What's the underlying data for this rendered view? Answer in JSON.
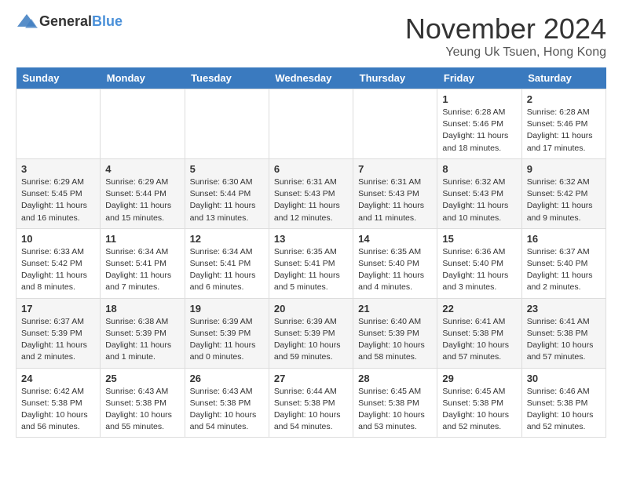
{
  "header": {
    "logo_general": "General",
    "logo_blue": "Blue",
    "month_title": "November 2024",
    "location": "Yeung Uk Tsuen, Hong Kong"
  },
  "days_of_week": [
    "Sunday",
    "Monday",
    "Tuesday",
    "Wednesday",
    "Thursday",
    "Friday",
    "Saturday"
  ],
  "weeks": [
    [
      {
        "day": "",
        "info": ""
      },
      {
        "day": "",
        "info": ""
      },
      {
        "day": "",
        "info": ""
      },
      {
        "day": "",
        "info": ""
      },
      {
        "day": "",
        "info": ""
      },
      {
        "day": "1",
        "info": "Sunrise: 6:28 AM\nSunset: 5:46 PM\nDaylight: 11 hours and 18 minutes."
      },
      {
        "day": "2",
        "info": "Sunrise: 6:28 AM\nSunset: 5:46 PM\nDaylight: 11 hours and 17 minutes."
      }
    ],
    [
      {
        "day": "3",
        "info": "Sunrise: 6:29 AM\nSunset: 5:45 PM\nDaylight: 11 hours and 16 minutes."
      },
      {
        "day": "4",
        "info": "Sunrise: 6:29 AM\nSunset: 5:44 PM\nDaylight: 11 hours and 15 minutes."
      },
      {
        "day": "5",
        "info": "Sunrise: 6:30 AM\nSunset: 5:44 PM\nDaylight: 11 hours and 13 minutes."
      },
      {
        "day": "6",
        "info": "Sunrise: 6:31 AM\nSunset: 5:43 PM\nDaylight: 11 hours and 12 minutes."
      },
      {
        "day": "7",
        "info": "Sunrise: 6:31 AM\nSunset: 5:43 PM\nDaylight: 11 hours and 11 minutes."
      },
      {
        "day": "8",
        "info": "Sunrise: 6:32 AM\nSunset: 5:43 PM\nDaylight: 11 hours and 10 minutes."
      },
      {
        "day": "9",
        "info": "Sunrise: 6:32 AM\nSunset: 5:42 PM\nDaylight: 11 hours and 9 minutes."
      }
    ],
    [
      {
        "day": "10",
        "info": "Sunrise: 6:33 AM\nSunset: 5:42 PM\nDaylight: 11 hours and 8 minutes."
      },
      {
        "day": "11",
        "info": "Sunrise: 6:34 AM\nSunset: 5:41 PM\nDaylight: 11 hours and 7 minutes."
      },
      {
        "day": "12",
        "info": "Sunrise: 6:34 AM\nSunset: 5:41 PM\nDaylight: 11 hours and 6 minutes."
      },
      {
        "day": "13",
        "info": "Sunrise: 6:35 AM\nSunset: 5:41 PM\nDaylight: 11 hours and 5 minutes."
      },
      {
        "day": "14",
        "info": "Sunrise: 6:35 AM\nSunset: 5:40 PM\nDaylight: 11 hours and 4 minutes."
      },
      {
        "day": "15",
        "info": "Sunrise: 6:36 AM\nSunset: 5:40 PM\nDaylight: 11 hours and 3 minutes."
      },
      {
        "day": "16",
        "info": "Sunrise: 6:37 AM\nSunset: 5:40 PM\nDaylight: 11 hours and 2 minutes."
      }
    ],
    [
      {
        "day": "17",
        "info": "Sunrise: 6:37 AM\nSunset: 5:39 PM\nDaylight: 11 hours and 2 minutes."
      },
      {
        "day": "18",
        "info": "Sunrise: 6:38 AM\nSunset: 5:39 PM\nDaylight: 11 hours and 1 minute."
      },
      {
        "day": "19",
        "info": "Sunrise: 6:39 AM\nSunset: 5:39 PM\nDaylight: 11 hours and 0 minutes."
      },
      {
        "day": "20",
        "info": "Sunrise: 6:39 AM\nSunset: 5:39 PM\nDaylight: 10 hours and 59 minutes."
      },
      {
        "day": "21",
        "info": "Sunrise: 6:40 AM\nSunset: 5:39 PM\nDaylight: 10 hours and 58 minutes."
      },
      {
        "day": "22",
        "info": "Sunrise: 6:41 AM\nSunset: 5:38 PM\nDaylight: 10 hours and 57 minutes."
      },
      {
        "day": "23",
        "info": "Sunrise: 6:41 AM\nSunset: 5:38 PM\nDaylight: 10 hours and 57 minutes."
      }
    ],
    [
      {
        "day": "24",
        "info": "Sunrise: 6:42 AM\nSunset: 5:38 PM\nDaylight: 10 hours and 56 minutes."
      },
      {
        "day": "25",
        "info": "Sunrise: 6:43 AM\nSunset: 5:38 PM\nDaylight: 10 hours and 55 minutes."
      },
      {
        "day": "26",
        "info": "Sunrise: 6:43 AM\nSunset: 5:38 PM\nDaylight: 10 hours and 54 minutes."
      },
      {
        "day": "27",
        "info": "Sunrise: 6:44 AM\nSunset: 5:38 PM\nDaylight: 10 hours and 54 minutes."
      },
      {
        "day": "28",
        "info": "Sunrise: 6:45 AM\nSunset: 5:38 PM\nDaylight: 10 hours and 53 minutes."
      },
      {
        "day": "29",
        "info": "Sunrise: 6:45 AM\nSunset: 5:38 PM\nDaylight: 10 hours and 52 minutes."
      },
      {
        "day": "30",
        "info": "Sunrise: 6:46 AM\nSunset: 5:38 PM\nDaylight: 10 hours and 52 minutes."
      }
    ]
  ]
}
